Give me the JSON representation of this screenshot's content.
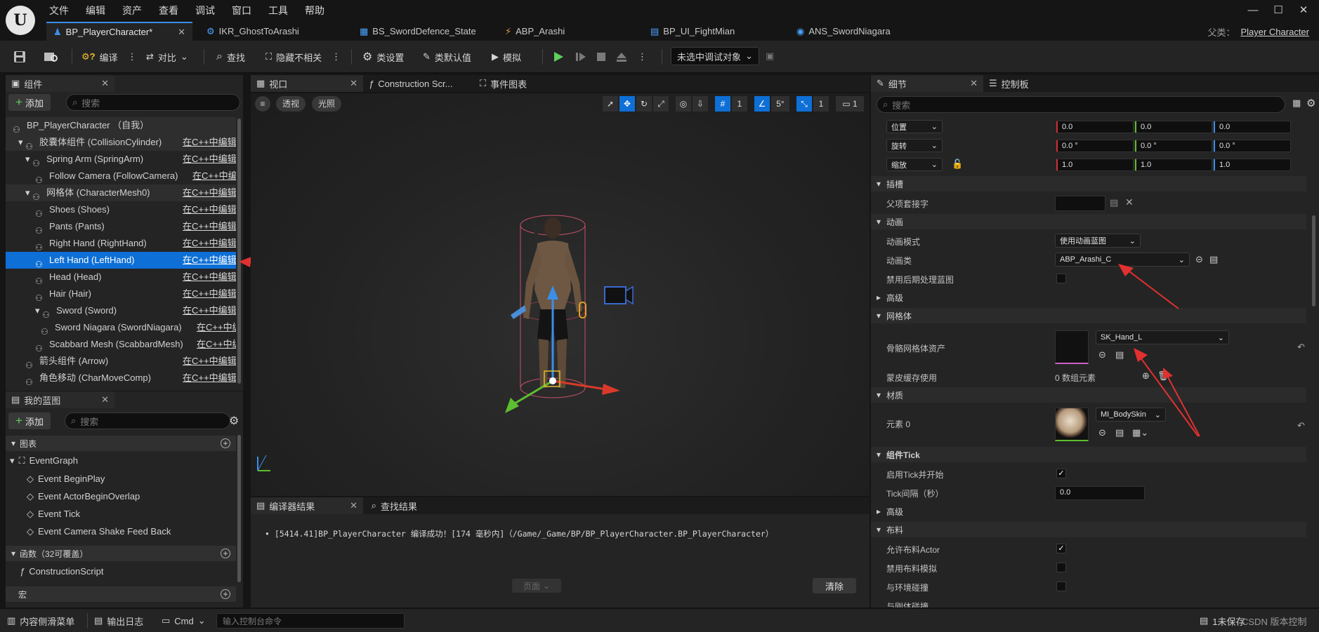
{
  "menu": [
    "文件",
    "编辑",
    "资产",
    "查看",
    "调试",
    "窗口",
    "工具",
    "帮助"
  ],
  "tabs": [
    {
      "label": "BP_PlayerCharacter*",
      "active": true
    },
    {
      "label": "IKR_GhostToArashi"
    },
    {
      "label": "BS_SwordDefence_State"
    },
    {
      "label": "ABP_Arashi"
    },
    {
      "label": "BP_UI_FightMian"
    },
    {
      "label": "ANS_SwordNiagara"
    }
  ],
  "parent": {
    "label": "父类：",
    "value": "Player Character"
  },
  "toolbar": {
    "compile": "编译",
    "diff": "对比",
    "find": "查找",
    "hide_unrelated": "隐藏不相关",
    "class_settings": "类设置",
    "class_defaults": "类默认值",
    "simulate": "模拟",
    "debug_target": "未选中调试对象"
  },
  "components_panel": {
    "title": "组件",
    "add": "添加",
    "search_placeholder": "搜索",
    "items": [
      {
        "label": "BP_PlayerCharacter （自我）",
        "link": "",
        "indent": 0
      },
      {
        "label": "胶囊体组件 (CollisionCylinder)",
        "link": "在C++中编辑",
        "indent": 1
      },
      {
        "label": "Spring Arm (SpringArm)",
        "link": "在C++中编辑",
        "indent": 2
      },
      {
        "label": "Follow Camera (FollowCamera)",
        "link": "在C++中编辑",
        "indent": 3
      },
      {
        "label": "网格体 (CharacterMesh0)",
        "link": "在C++中编辑",
        "indent": 2
      },
      {
        "label": "Shoes (Shoes)",
        "link": "在C++中编辑",
        "indent": 3
      },
      {
        "label": "Pants (Pants)",
        "link": "在C++中编辑",
        "indent": 3
      },
      {
        "label": "Right Hand (RightHand)",
        "link": "在C++中编辑",
        "indent": 3
      },
      {
        "label": "Left Hand (LeftHand)",
        "link": "在C++中编辑",
        "indent": 3,
        "selected": true
      },
      {
        "label": "Head (Head)",
        "link": "在C++中编辑",
        "indent": 3
      },
      {
        "label": "Hair (Hair)",
        "link": "在C++中编辑",
        "indent": 3
      },
      {
        "label": "Sword (Sword)",
        "link": "在C++中编辑",
        "indent": 3
      },
      {
        "label": "Sword Niagara (SwordNiagara)",
        "link": "在C++中编辑",
        "indent": 4
      },
      {
        "label": "Scabbard Mesh (ScabbardMesh)",
        "link": "在C++中编辑",
        "indent": 3
      },
      {
        "label": "箭头组件 (Arrow)",
        "link": "在C++中编辑",
        "indent": 2
      },
      {
        "label": "角色移动 (CharMoveComp)",
        "link": "在C++中编辑",
        "indent": 2
      }
    ]
  },
  "blueprint_panel": {
    "title": "我的蓝图",
    "add": "添加",
    "search_placeholder": "搜索",
    "graphs_label": "图表",
    "event_graph": "EventGraph",
    "events": [
      "Event BeginPlay",
      "Event ActorBeginOverlap",
      "Event Tick",
      "Event Camera Shake Feed Back"
    ],
    "functions_label": "函数（32可覆盖）",
    "construction": "ConstructionScript",
    "macros_label": "宏"
  },
  "viewport": {
    "tabs": [
      "视口",
      "Construction Scr...",
      "事件图表"
    ],
    "perspective": "透视",
    "lit": "光照",
    "grid_value": "1",
    "angle_value": "5°",
    "scale_value": "1",
    "cam_value": "1"
  },
  "compiler": {
    "tabs": [
      "编译器结果",
      "查找结果"
    ],
    "message": "[5414.41]BP_PlayerCharacter 编译成功！[174 毫秒内]（/Game/_Game/BP/BP_PlayerCharacter.BP_PlayerCharacter）",
    "page": "页面",
    "clear": "清除"
  },
  "details": {
    "tabs": [
      "细节",
      "控制板"
    ],
    "search_placeholder": "搜索",
    "location": {
      "label": "位置",
      "x": "0.0",
      "y": "0.0",
      "z": "0.0"
    },
    "rotation": {
      "label": "旋转",
      "x": "0.0 °",
      "y": "0.0 °",
      "z": "0.0 °"
    },
    "scale": {
      "label": "缩放",
      "x": "1.0",
      "y": "1.0",
      "z": "1.0"
    },
    "socket_cat": "插槽",
    "parent_socket": "父项套接字",
    "anim_cat": "动画",
    "anim_mode_label": "动画模式",
    "anim_mode": "使用动画蓝图",
    "anim_class_label": "动画类",
    "anim_class": "ABP_Arashi_C",
    "disable_post": "禁用后期处理蓝图",
    "advanced": "高级",
    "mesh_cat": "网格体",
    "skel_mesh_label": "骨骼网格体资产",
    "skel_mesh": "SK_Hand_L",
    "skin_cache": "蒙皮缓存使用",
    "skin_cache_value": "0 数组元素",
    "material_cat": "材质",
    "element0": "元素 0",
    "material": "MI_BodySkin",
    "tick_cat": "组件Tick",
    "tick_enable": "启用Tick并开始",
    "tick_interval": "Tick间隔（秒）",
    "tick_value": "0.0",
    "advanced2": "高级",
    "cloth_cat": "布料",
    "cloth_allow": "允许布料Actor",
    "cloth_disable": "禁用布料模拟",
    "env_collide": "与环境碰撞",
    "last_row": "与刚体碰撞"
  },
  "statusbar": {
    "content_drawer": "内容侧滑菜单",
    "output_log": "输出日志",
    "cmd": "Cmd",
    "console_placeholder": "输入控制台命令",
    "unsaved": "1未保存",
    "right_text": "CSDN 版本控制"
  }
}
